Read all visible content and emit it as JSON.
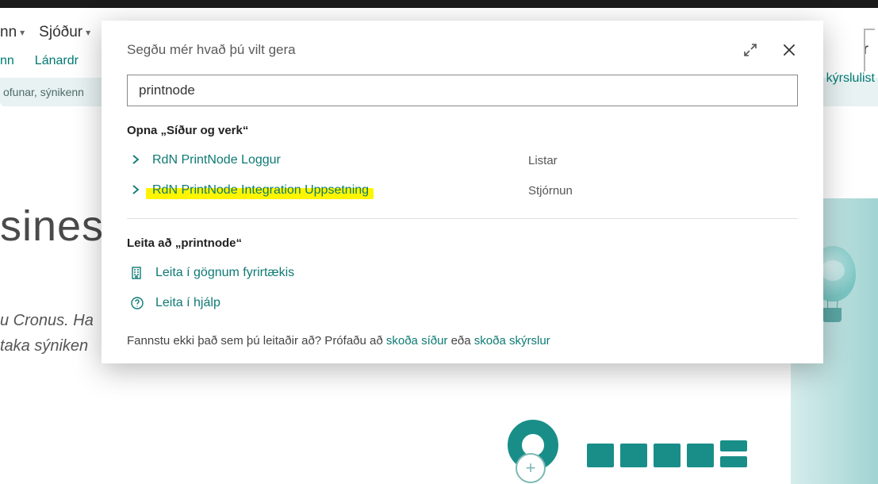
{
  "background": {
    "nav_left_item": "nn",
    "nav_sjodur": "Sjóður",
    "subnav_left": "nn",
    "subnav_lanardr": "Lánardr",
    "subnav_right_partial": "kýrslulist",
    "band_text": "ofunar, sýnikenn",
    "hero_partial": "siness",
    "greeting_line1": "u Cronus. Ha",
    "greeting_line2": "taka sýniken",
    "right_nav_r": "r",
    "plus_glyph": "+"
  },
  "modal": {
    "title": "Segðu mér hvað þú vilt gera",
    "search_value": "printnode",
    "open_section_title": "Opna „Síður og verk“",
    "results": [
      {
        "label": "RdN PrintNode Loggur",
        "category": "Listar",
        "highlighted": false
      },
      {
        "label": "RdN PrintNode Integration Uppsetning",
        "category": "Stjórnun",
        "highlighted": true
      }
    ],
    "search_section_title": "Leita að „printnode“",
    "search_in_company": "Leita í gögnum fyrirtækis",
    "search_in_help": "Leita í hjálp",
    "footer_prefix": "Fannstu ekki það sem þú leitaðir að? Prófaðu að ",
    "footer_link_pages": "skoða síður",
    "footer_sep": " eða ",
    "footer_link_reports": "skoða skýrslur"
  }
}
